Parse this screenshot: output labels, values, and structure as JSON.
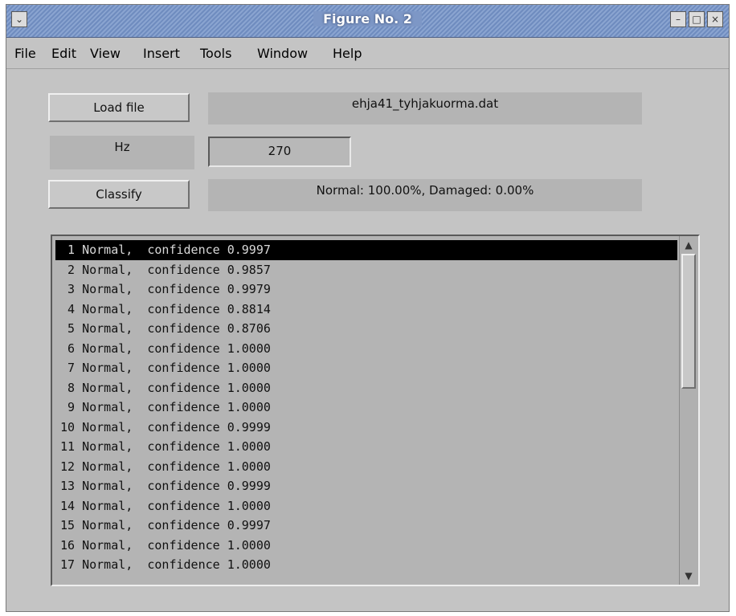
{
  "window": {
    "title": "Figure No. 2",
    "controls": {
      "menu": "⌄",
      "minimize": "–",
      "maximize": "□",
      "close": "×"
    }
  },
  "menubar": {
    "items": [
      "File",
      "Edit",
      "View",
      "Insert",
      "Tools",
      "Window",
      "Help"
    ]
  },
  "controls": {
    "load_button": "Load file",
    "filename": "ehja41_tyhjakuorma.dat",
    "hz_label": "Hz",
    "hz_value": "270",
    "classify_button": "Classify",
    "result_text": "Normal: 100.00%, Damaged: 0.00%"
  },
  "results": {
    "selected_index": 0,
    "rows": [
      " 1 Normal,  confidence 0.9997",
      " 2 Normal,  confidence 0.9857",
      " 3 Normal,  confidence 0.9979",
      " 4 Normal,  confidence 0.8814",
      " 5 Normal,  confidence 0.8706",
      " 6 Normal,  confidence 1.0000",
      " 7 Normal,  confidence 1.0000",
      " 8 Normal,  confidence 1.0000",
      " 9 Normal,  confidence 1.0000",
      "10 Normal,  confidence 0.9999",
      "11 Normal,  confidence 1.0000",
      "12 Normal,  confidence 1.0000",
      "13 Normal,  confidence 0.9999",
      "14 Normal,  confidence 1.0000",
      "15 Normal,  confidence 0.9997",
      "16 Normal,  confidence 1.0000",
      "17 Normal,  confidence 1.0000"
    ]
  },
  "scrollbar": {
    "up_arrow": "▲",
    "down_arrow": "▼"
  },
  "colors": {
    "window_bg": "#c4c4c4",
    "titlebar": "#7d97c6",
    "selection": "#000000"
  }
}
